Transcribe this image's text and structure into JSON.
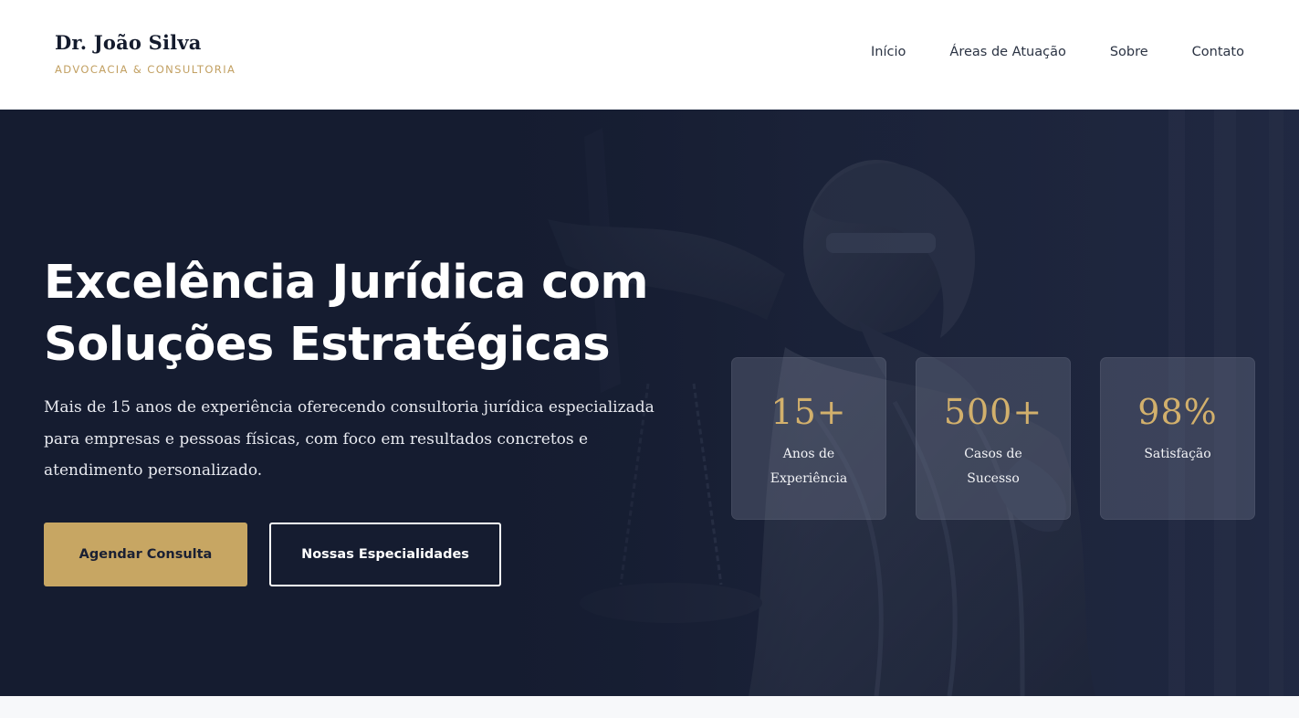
{
  "header": {
    "brand_name": "Dr. João Silva",
    "brand_tagline": "ADVOCACIA & CONSULTORIA",
    "nav": [
      "Início",
      "Áreas de Atuação",
      "Sobre",
      "Contato"
    ]
  },
  "hero": {
    "title_line1": "Excelência Jurídica com",
    "title_line2": "Soluções Estratégicas",
    "description": "Mais de 15 anos de experiência oferecendo consultoria jurídica especializada para empresas e pessoas físicas, com foco em resultados concretos e atendimento personalizado.",
    "primary_button": "Agendar Consulta",
    "secondary_button": "Nossas Especialidades",
    "background_image": "statue-of-justice-icon"
  },
  "stats": [
    {
      "value": "15+",
      "label": "Anos de Experiência"
    },
    {
      "value": "500+",
      "label": "Casos de Sucesso"
    },
    {
      "value": "98%",
      "label": "Satisfação"
    }
  ],
  "colors": {
    "navy": "#182037",
    "gold": "#c7a663",
    "white": "#ffffff"
  }
}
